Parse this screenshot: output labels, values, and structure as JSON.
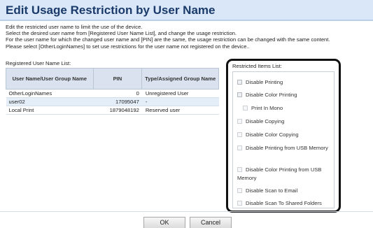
{
  "page": {
    "title": "Edit Usage Restriction by User Name",
    "description_lines": [
      "Edit the restricted user name to limit the use of the device.",
      "Select the desired user name from [Registered User Name List], and change the usage restriction.",
      "For the user name for which the changed user name and [PIN] are the same, the usage restriction can be changed with the same content.",
      "Please select [OtherLoginNames] to set use restrictions for the user name not registered on the device.."
    ]
  },
  "registered_list": {
    "label": "Registered User Name List:",
    "columns": [
      "User Name/User Group Name",
      "PIN",
      "Type/Assigned Group Name"
    ],
    "rows": [
      {
        "name": "OtherLoginNames",
        "pin": "0",
        "type": "Unregistered User"
      },
      {
        "name": "user02",
        "pin": "17095047",
        "type": "-"
      },
      {
        "name": "Local Print",
        "pin": "1879048192",
        "type": "Reserved user"
      }
    ]
  },
  "restricted": {
    "label": "Restricted Items List:",
    "items": [
      "Disable Printing",
      "Disable Color Printing",
      "Print In Mono",
      "Disable Copying",
      "Disable Color Copying",
      "Disable Printing from USB Memory",
      "Disable Color Printing from USB Memory",
      "Disable Scan to Email",
      "Disable Scan To Shared Folders"
    ]
  },
  "buttons": {
    "ok": "OK",
    "cancel": "Cancel"
  },
  "colors": {
    "title_bg": "#d9e7f8",
    "title_text": "#1a3a6a",
    "header_bg": "#d9e2ee",
    "selected_row": "#e4eef9",
    "highlight_frame": "#111111"
  }
}
